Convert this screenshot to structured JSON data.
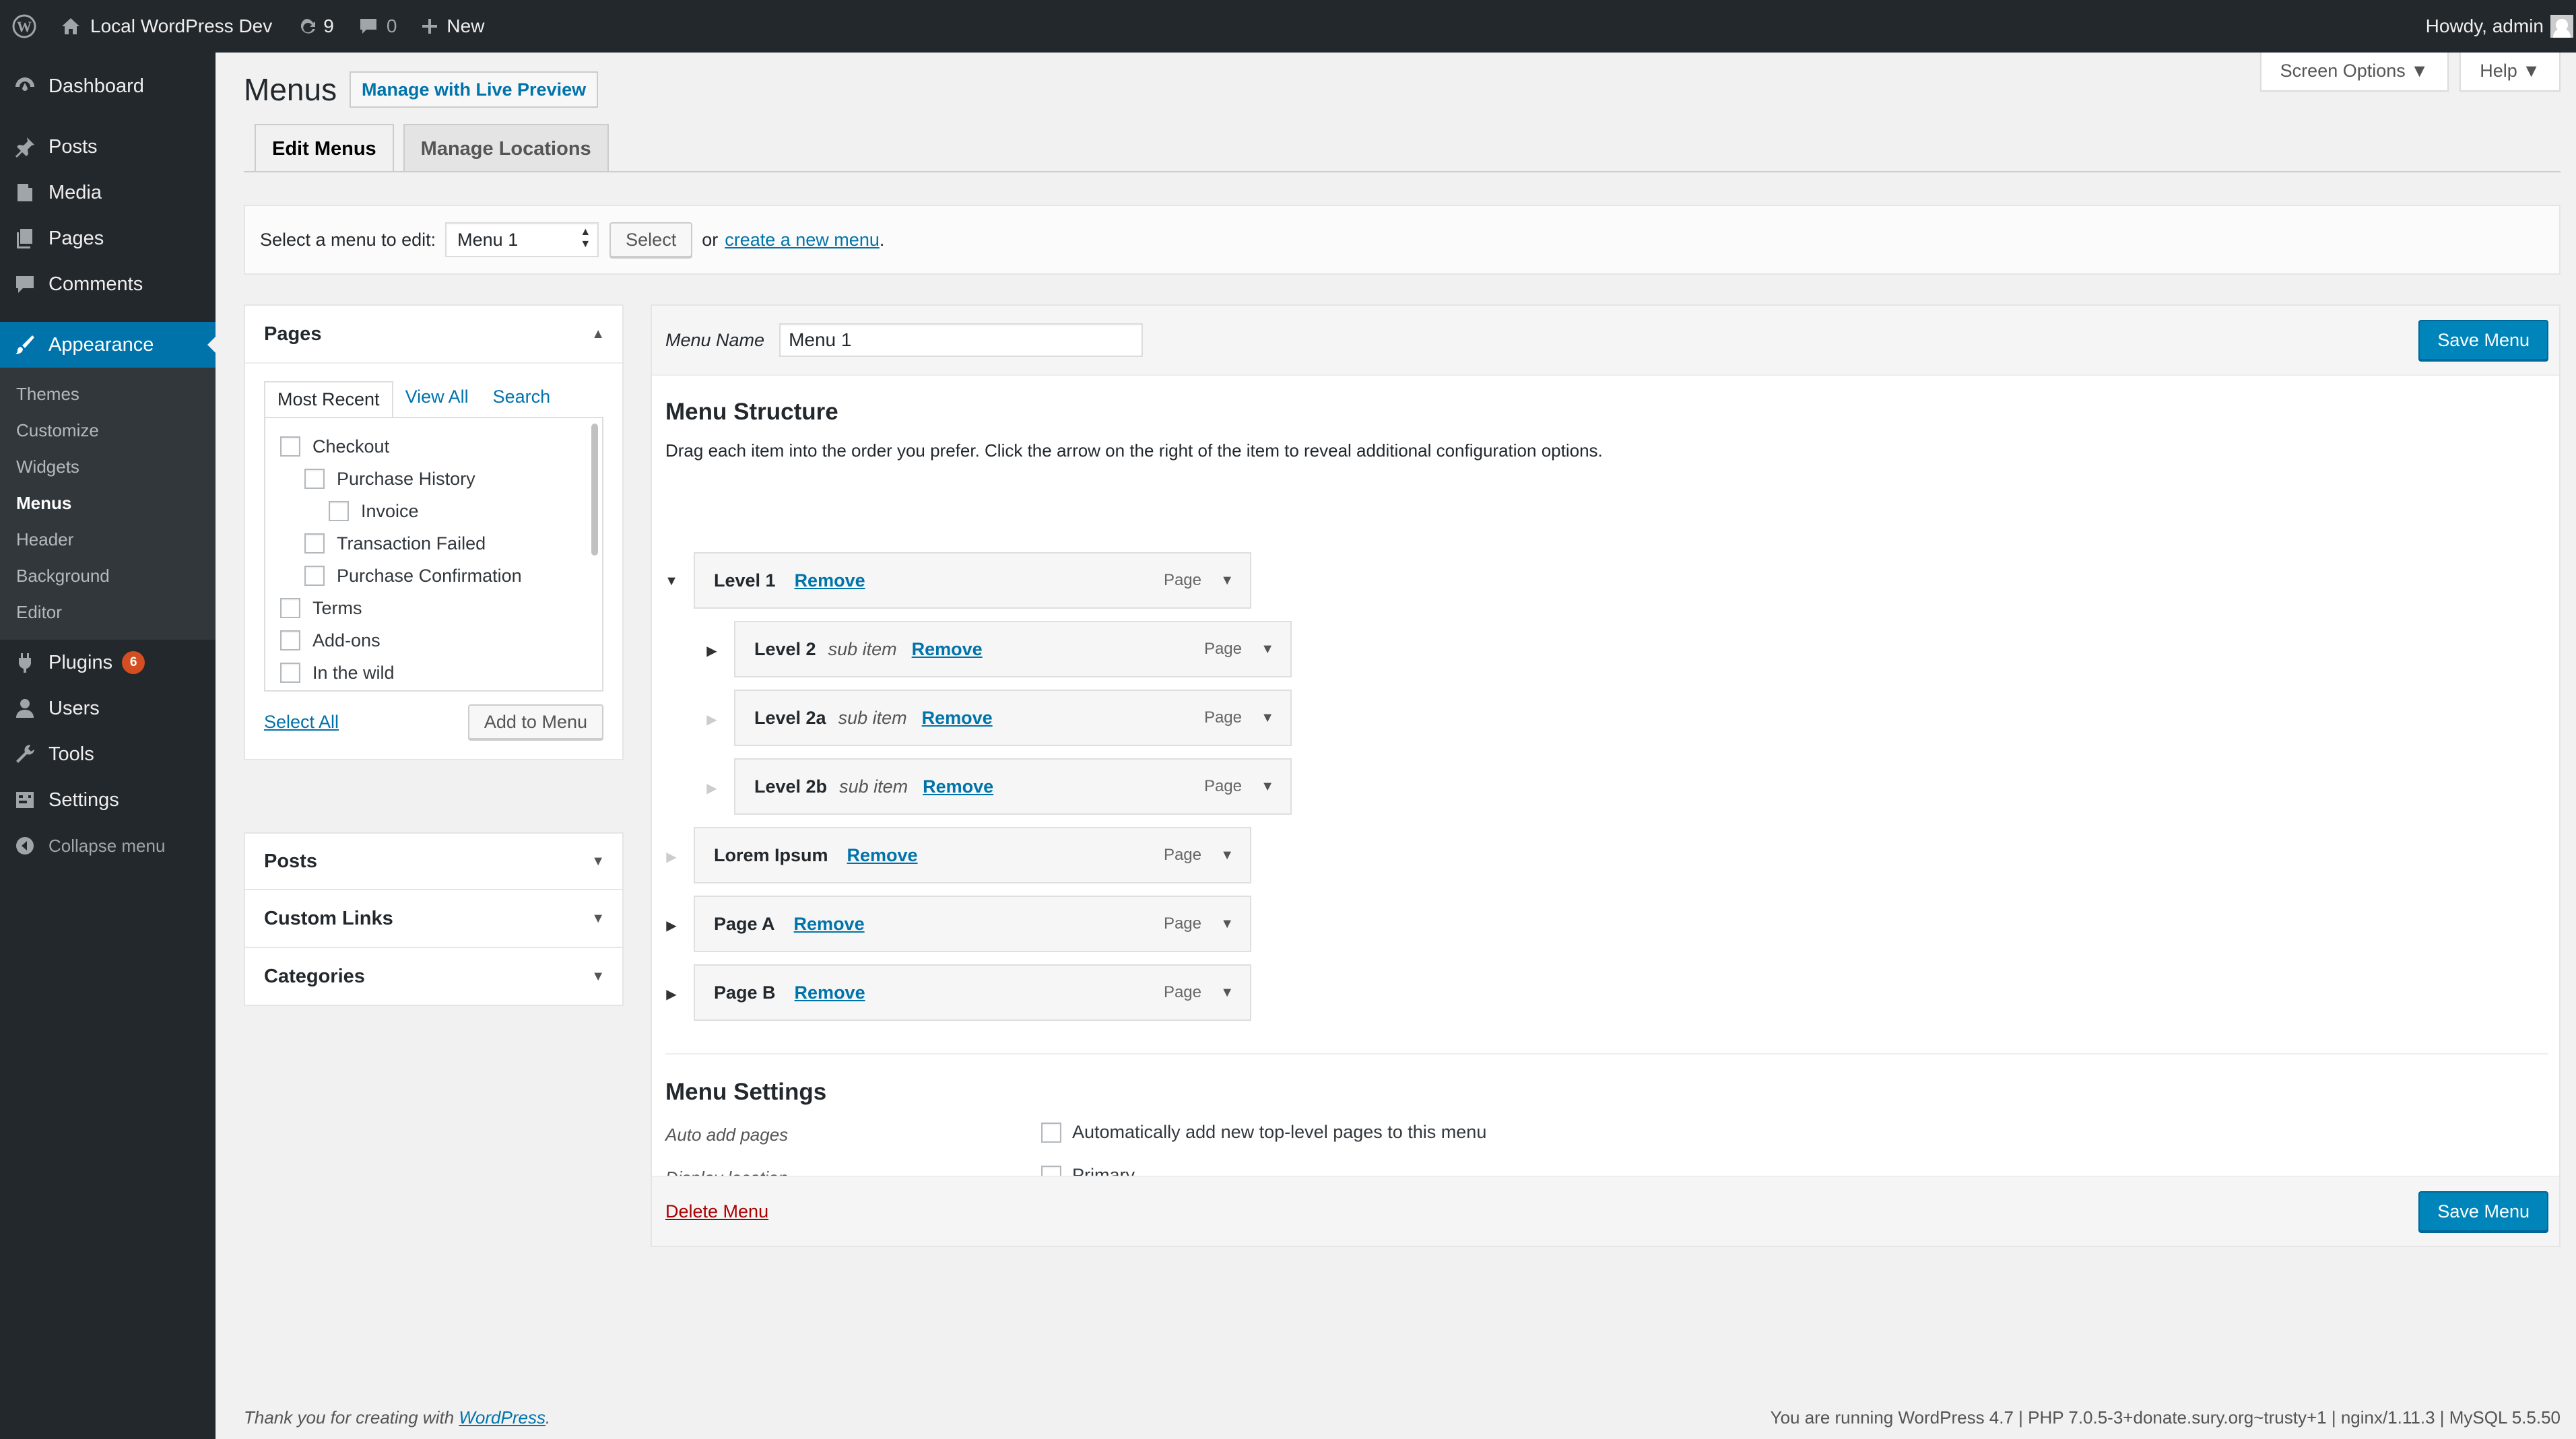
{
  "adminbar": {
    "site_name": "Local WordPress Dev",
    "updates_count": "9",
    "comments_count": "0",
    "new_label": "New",
    "howdy": "Howdy, admin"
  },
  "sidebar": {
    "dashboard": "Dashboard",
    "posts": "Posts",
    "media": "Media",
    "pages": "Pages",
    "comments": "Comments",
    "appearance": "Appearance",
    "appearance_sub": [
      "Themes",
      "Customize",
      "Widgets",
      "Menus",
      "Header",
      "Background",
      "Editor"
    ],
    "plugins": "Plugins",
    "plugins_badge": "6",
    "users": "Users",
    "tools": "Tools",
    "settings": "Settings",
    "collapse": "Collapse menu"
  },
  "header": {
    "title": "Menus",
    "live_preview": "Manage with Live Preview",
    "screen_options": "Screen Options ▼",
    "help": "Help ▼"
  },
  "tabs": {
    "edit": "Edit Menus",
    "locations": "Manage Locations"
  },
  "select_bar": {
    "label": "Select a menu to edit:",
    "selected": "Menu 1",
    "select_button": "Select",
    "or": "or",
    "create_link": "create a new menu",
    "period": "."
  },
  "pages_box": {
    "title": "Pages",
    "tabs": [
      "Most Recent",
      "View All",
      "Search"
    ],
    "items": [
      {
        "label": "Checkout",
        "depth": 0
      },
      {
        "label": "Purchase History",
        "depth": 1
      },
      {
        "label": "Invoice",
        "depth": 2
      },
      {
        "label": "Transaction Failed",
        "depth": 1
      },
      {
        "label": "Purchase Confirmation",
        "depth": 1
      },
      {
        "label": "Terms",
        "depth": 0
      },
      {
        "label": "Add-ons",
        "depth": 0
      },
      {
        "label": "In the wild",
        "depth": 0
      }
    ],
    "select_all": "Select All",
    "add_button": "Add to Menu"
  },
  "collapsed_boxes": [
    "Posts",
    "Custom Links",
    "Categories"
  ],
  "menu_editor": {
    "name_label": "Menu Name",
    "name_value": "Menu 1",
    "save_label": "Save Menu",
    "structure_title": "Menu Structure",
    "structure_desc": "Drag each item into the order you prefer. Click the arrow on the right of the item to reveal additional configuration options.",
    "items": [
      {
        "title": "Level 1",
        "sub": "",
        "type": "Page",
        "remove": "Remove"
      },
      {
        "title": "Level 2",
        "sub": "sub item",
        "type": "Page",
        "remove": "Remove"
      },
      {
        "title": "Level 2a",
        "sub": "sub item",
        "type": "Page",
        "remove": "Remove"
      },
      {
        "title": "Level 2b",
        "sub": "sub item",
        "type": "Page",
        "remove": "Remove"
      },
      {
        "title": "Lorem Ipsum",
        "sub": "",
        "type": "Page",
        "remove": "Remove"
      },
      {
        "title": "Page A",
        "sub": "",
        "type": "Page",
        "remove": "Remove"
      },
      {
        "title": "Page B",
        "sub": "",
        "type": "Page",
        "remove": "Remove"
      }
    ],
    "settings_title": "Menu Settings",
    "auto_add_label": "Auto add pages",
    "auto_add_option": "Automatically add new top-level pages to this menu",
    "display_label": "Display location",
    "display_option": "Primary",
    "delete_label": "Delete Menu"
  },
  "footer": {
    "thanks_prefix": "Thank you for creating with ",
    "thanks_link": "WordPress",
    "thanks_suffix": ".",
    "version": "You are running WordPress 4.7 | PHP 7.0.5-3+donate.sury.org~trusty+1 | nginx/1.11.3 | MySQL 5.5.50"
  }
}
